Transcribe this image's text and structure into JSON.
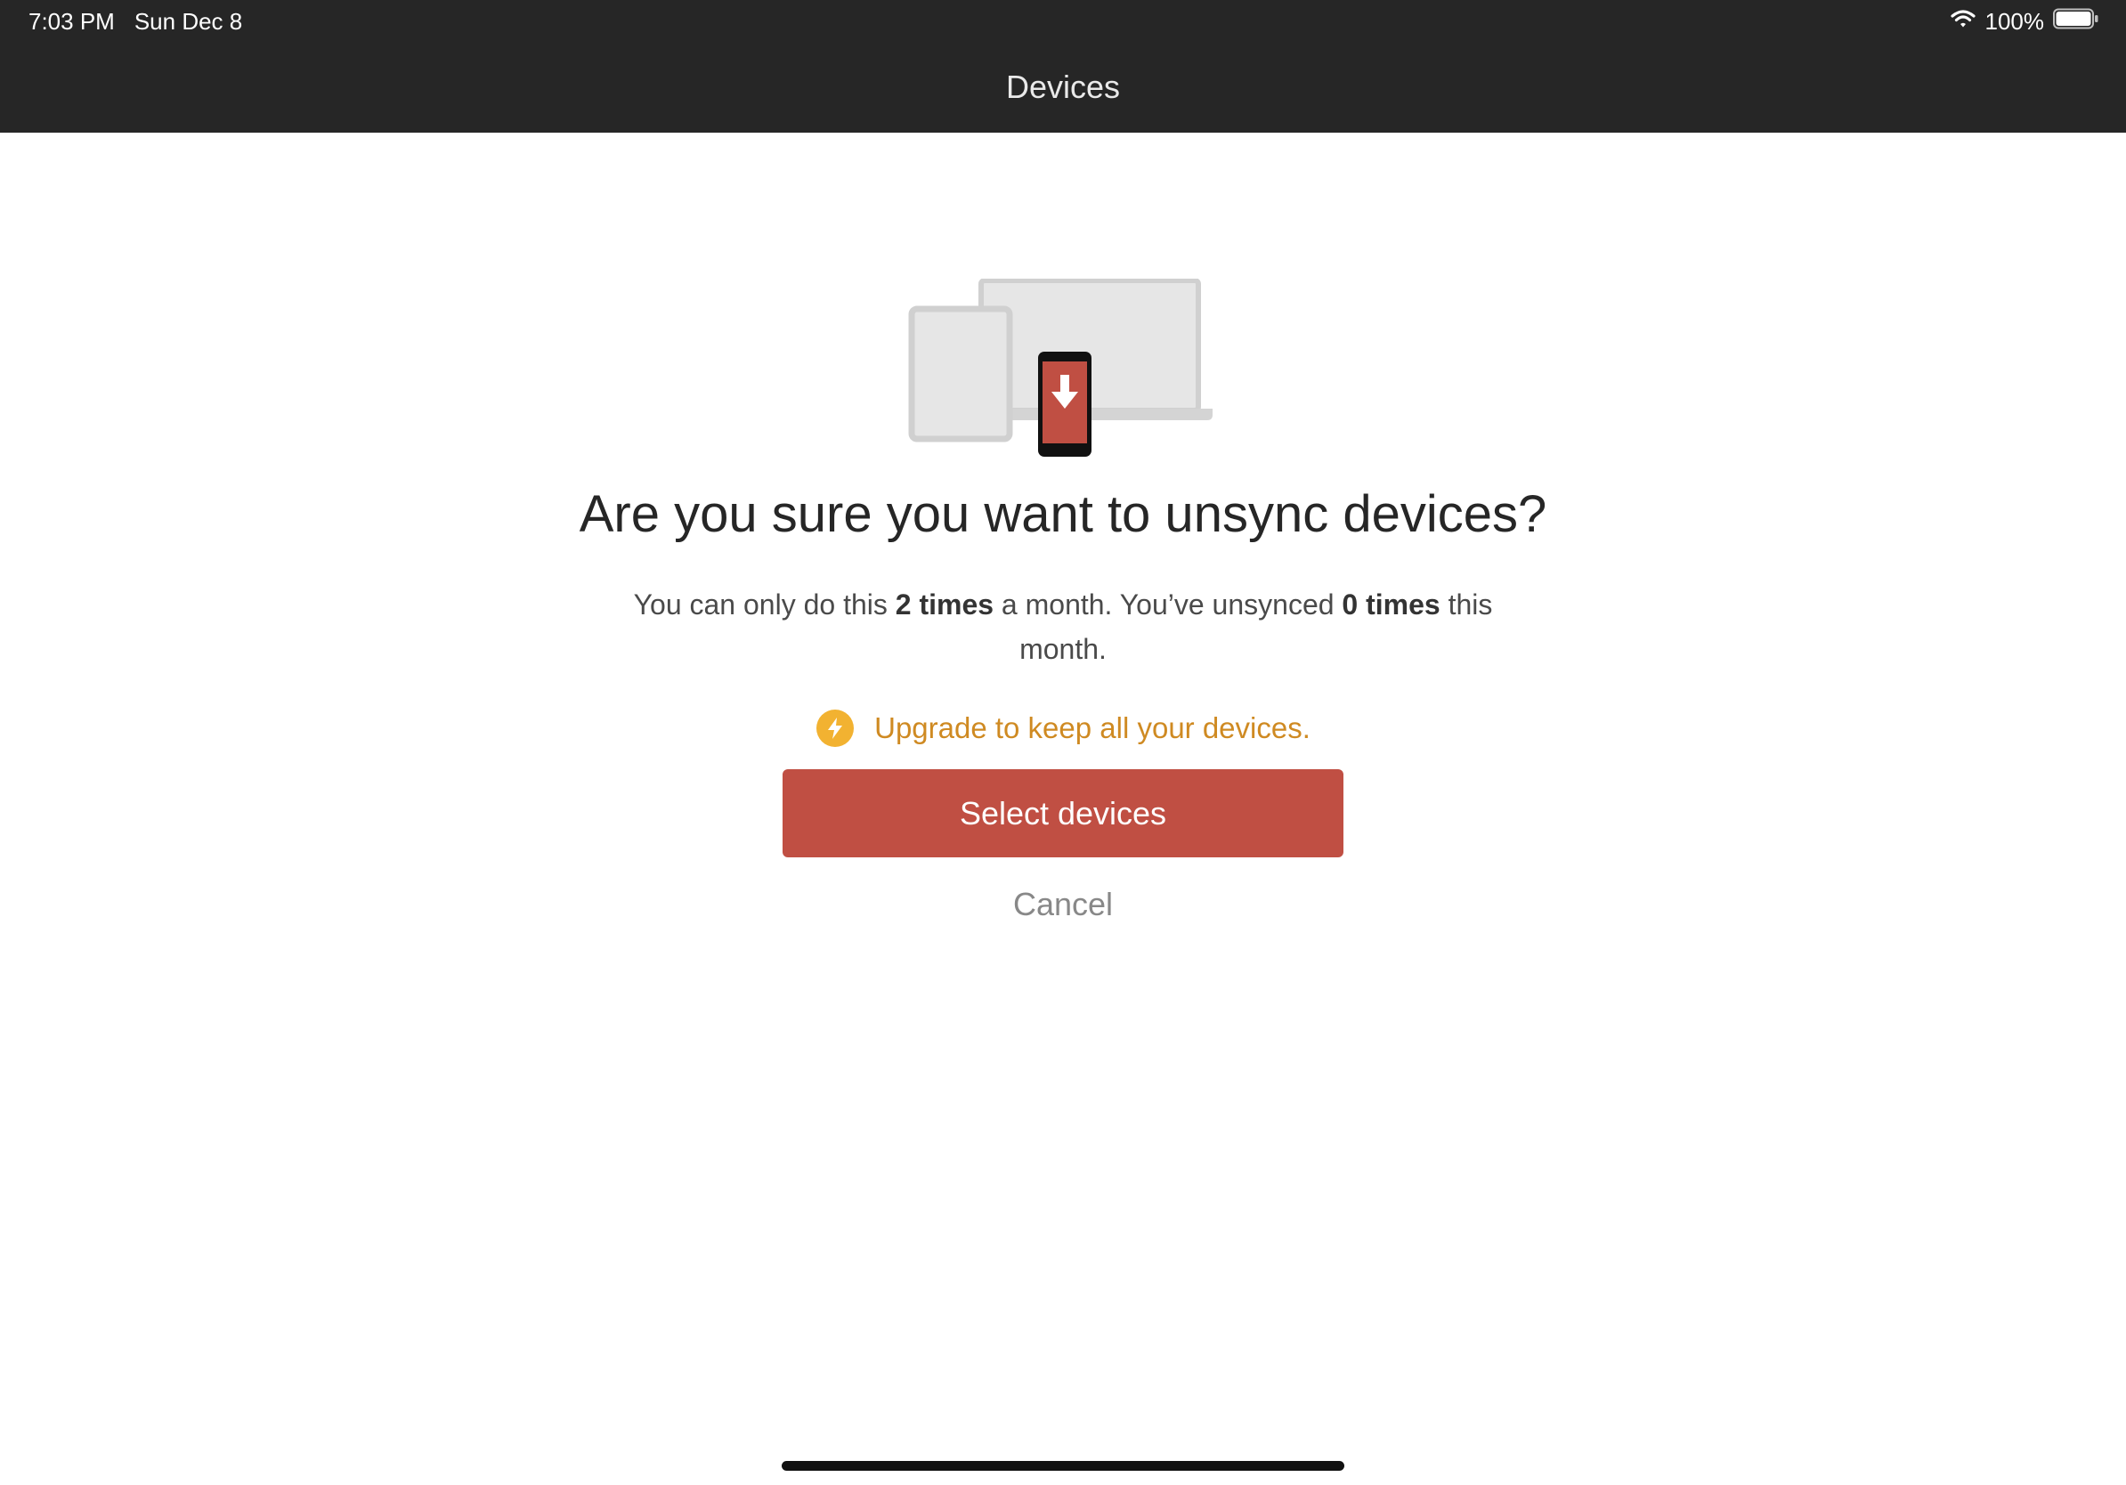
{
  "status_bar": {
    "time": "7:03 PM",
    "date": "Sun Dec 8",
    "battery_text": "100%",
    "battery_level": 1.0
  },
  "nav": {
    "title": "Devices"
  },
  "dialog": {
    "headline": "Are you sure you want to unsync devices?",
    "desc_part1": "You can only do this ",
    "desc_bold1": "2 times",
    "desc_part2": " a month. You’ve unsynced ",
    "desc_bold2": "0 times",
    "desc_part3": " this month.",
    "upgrade_text": "Upgrade to keep all your devices.",
    "primary_button": "Select devices",
    "cancel_button": "Cancel"
  },
  "colors": {
    "topbar": "#262626",
    "accent_red": "#c04f43",
    "upgrade_gold": "#cf8a22",
    "upgrade_icon": "#f2b231"
  },
  "icons": {
    "illustration": "devices-unsync-illustration",
    "upgrade": "lightning-bolt-icon",
    "wifi": "wifi-icon",
    "battery": "battery-icon"
  }
}
